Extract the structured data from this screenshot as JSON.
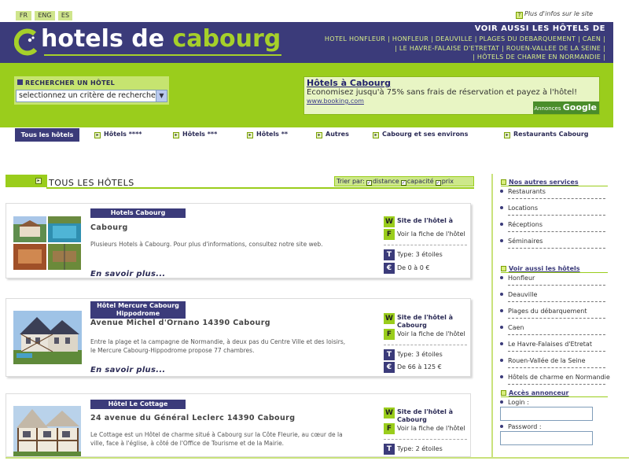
{
  "languages": [
    "FR",
    "ENG",
    "ES"
  ],
  "top_help": "Plus d'infos sur le site",
  "logo": {
    "part1": "hotels de ",
    "part2": "cabourg"
  },
  "header": {
    "title": "VOIR AUSSI LES HÔTELS DE",
    "links": [
      "HOTEL HONFLEUR",
      "HONFLEUR",
      "DEAUVILLE",
      "PLAGES DU DEBARQUEMENT",
      "CAEN",
      "LE HAVRE-FALAISE D'ETRETAT",
      "ROUEN-VALLEE DE LA SEINE",
      "HÔTELS DE CHARME EN NORMANDIE"
    ]
  },
  "search": {
    "title": "RECHERCHER UN HÔTEL",
    "select_value": "selectionnez un critère de recherche"
  },
  "ad": {
    "title": "Hôtels à Cabourg",
    "text": "Economisez jusqu'à 75% sans frais de réservation et payez à l'hôtel!",
    "url": "www.booking.com",
    "google_prefix": "Annonces ",
    "google": "Google"
  },
  "nav": {
    "all": "Tous les hôtels",
    "items": [
      "Hôtels ****",
      "Hôtels ***",
      "Hôtels **",
      "Autres",
      "Cabourg et ses environs",
      "Restaurants Cabourg"
    ]
  },
  "section": {
    "title": "TOUS LES HÔTELS",
    "sort_label": "Trier par:",
    "sort_options": [
      "distance",
      "capacité",
      "prix"
    ]
  },
  "hotels": [
    {
      "badge": "Hotels Cabourg",
      "address": "Cabourg",
      "description": "Plusieurs Hotels à Cabourg. Pour plus d'informations, consultez notre site web.",
      "more": "En savoir plus...",
      "site_label": "Site de l'hôtel à",
      "sheet_label": "Voir la fiche de l'hôtel",
      "type": "Type: 3 étoiles",
      "price": "De 0 à 0 €"
    },
    {
      "badge": "Hôtel Mercure Cabourg Hippodrome",
      "address": "Avenue Michel d'Ornano  14390  Cabourg",
      "description": "Entre la plage et la campagne de Normandie, à deux pas du Centre Ville et des loisirs, le Mercure Cabourg-Hippodrome propose 77 chambres.",
      "more": "En savoir plus...",
      "site_label": "Site de l'hôtel à Cabourg",
      "sheet_label": "Voir la fiche de l'hôtel",
      "type": "Type: 3 étoiles",
      "price": "De 66 à 125 €"
    },
    {
      "badge": "Hôtel Le Cottage",
      "address": "24 avenue du Général Leclerc  14390  Cabourg",
      "description": "Le Cottage est un Hôtel de charme situé à Cabourg sur la Côte Fleurie, au cœur de la ville, face à l'église, à côté de l'Office de Tourisme et de la Mairie.",
      "site_label": "Site de l'hôtel à Cabourg",
      "sheet_label": "Voir la fiche de l'hôtel",
      "type": "Type: 2 étoiles"
    }
  ],
  "sidebar": {
    "services_title": "Nos autres services",
    "services": [
      "Restaurants",
      "Locations",
      "Réceptions",
      "Séminaires"
    ],
    "see_also_title": "Voir aussi les hôtels",
    "see_also": [
      "Honfleur",
      "Deauville",
      "Plages du débarquement",
      "Caen",
      "Le Havre-Falaises d'Etretat",
      "Rouen-Vallée de la Seine",
      "Hôtels de charme en Normandie"
    ],
    "login_title": "Accès annonceur",
    "login_label": "Login :",
    "password_label": "Password :"
  },
  "colors": {
    "navy": "#3b3b7a",
    "lime": "#9acd1c",
    "lime_light": "#c6e470"
  }
}
